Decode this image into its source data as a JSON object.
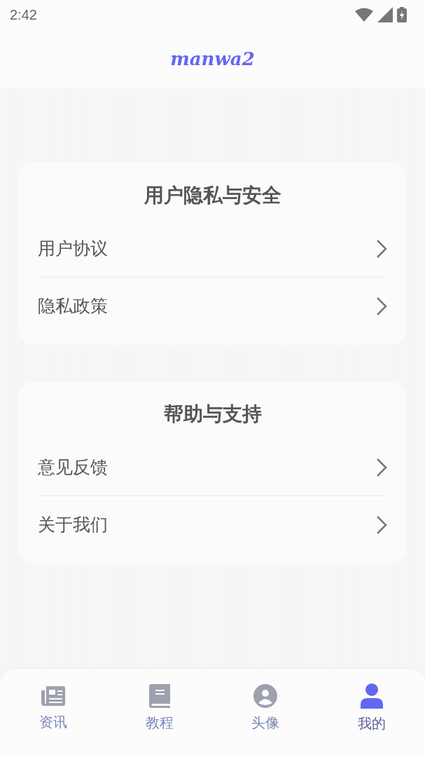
{
  "status_bar": {
    "time": "2:42"
  },
  "header": {
    "title": "manwa2"
  },
  "sections": [
    {
      "title": "用户隐私与安全",
      "items": [
        {
          "label": "用户协议"
        },
        {
          "label": "隐私政策"
        }
      ]
    },
    {
      "title": "帮助与支持",
      "items": [
        {
          "label": "意见反馈"
        },
        {
          "label": "关于我们"
        }
      ]
    }
  ],
  "bottom_nav": [
    {
      "label": "资讯",
      "kind": "news",
      "selected": false
    },
    {
      "label": "教程",
      "kind": "book",
      "selected": false
    },
    {
      "label": "头像",
      "kind": "avatar",
      "selected": false
    },
    {
      "label": "我的",
      "kind": "person",
      "selected": true
    }
  ]
}
